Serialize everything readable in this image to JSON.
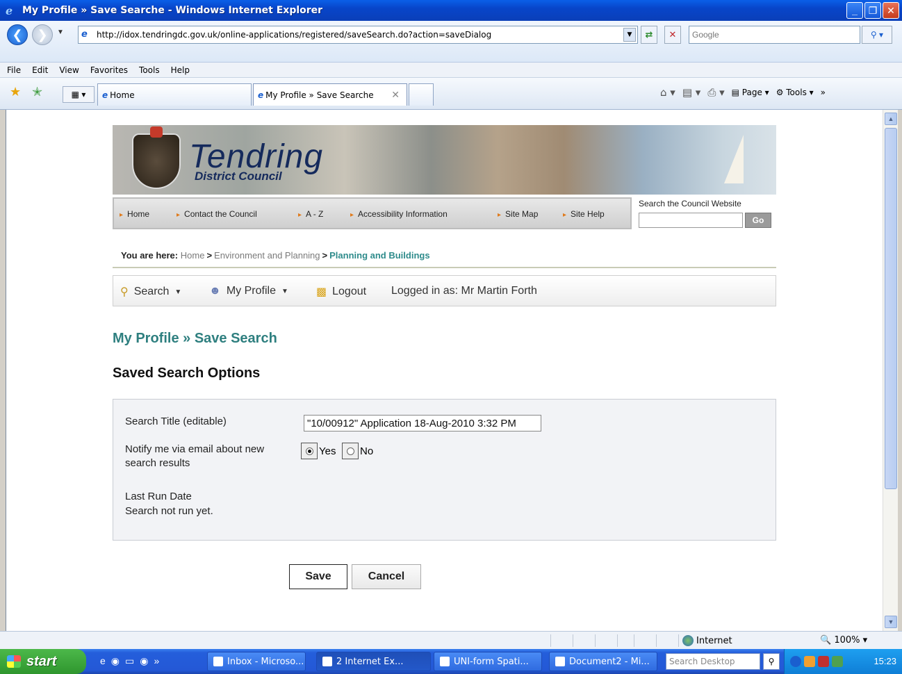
{
  "window": {
    "title": "My Profile » Save Searche - Windows Internet Explorer",
    "minimize": "_",
    "maximize": "❐",
    "close": "✕"
  },
  "browser": {
    "url": "http://idox.tendringdc.gov.uk/online-applications/registered/saveSearch.do?action=saveDialog",
    "search_placeholder": "Google",
    "menu": [
      "File",
      "Edit",
      "View",
      "Favorites",
      "Tools",
      "Help"
    ],
    "tabs": [
      {
        "label": "Home"
      },
      {
        "label": "My Profile » Save Searche"
      }
    ],
    "commands": {
      "page": "Page",
      "tools": "Tools"
    }
  },
  "site": {
    "brand": "Tendring",
    "brand_sub": "District Council",
    "nav": [
      "Home",
      "Contact the Council",
      "A - Z",
      "Accessibility Information",
      "Site Map",
      "Site Help"
    ],
    "search_label": "Search the Council Website",
    "search_go": "Go",
    "breadcrumb": {
      "prefix": "You are here:",
      "items": [
        "Home",
        "Environment and Planning",
        "Planning and Buildings"
      ],
      "separator": ">"
    }
  },
  "appbar": {
    "search": "Search",
    "my_profile": "My Profile",
    "logout": "Logout",
    "logged_in": "Logged in as: Mr Martin Forth"
  },
  "page": {
    "title": "My Profile » Save Search",
    "subtitle": "Saved Search Options",
    "form": {
      "search_title_label": "Search Title (editable)",
      "search_title_value": "\"10/00912\" Application 18-Aug-2010 3:32 PM",
      "notify_label_1": "Notify me via email about new",
      "notify_label_2": "search results",
      "notify_yes": "Yes",
      "notify_no": "No",
      "notify_selected": "Yes",
      "last_run_label": "Last Run Date",
      "last_run_value": "Search not run yet."
    },
    "buttons": {
      "save": "Save",
      "cancel": "Cancel"
    }
  },
  "status": {
    "zone": "Internet",
    "zoom": "100%"
  },
  "taskbar": {
    "start": "start",
    "tasks": [
      "Inbox - Microso...",
      "2 Internet Ex...",
      "UNI-form Spati...",
      "Document2 - Mi..."
    ],
    "desktop_search": "Search Desktop",
    "clock": "15:23"
  }
}
